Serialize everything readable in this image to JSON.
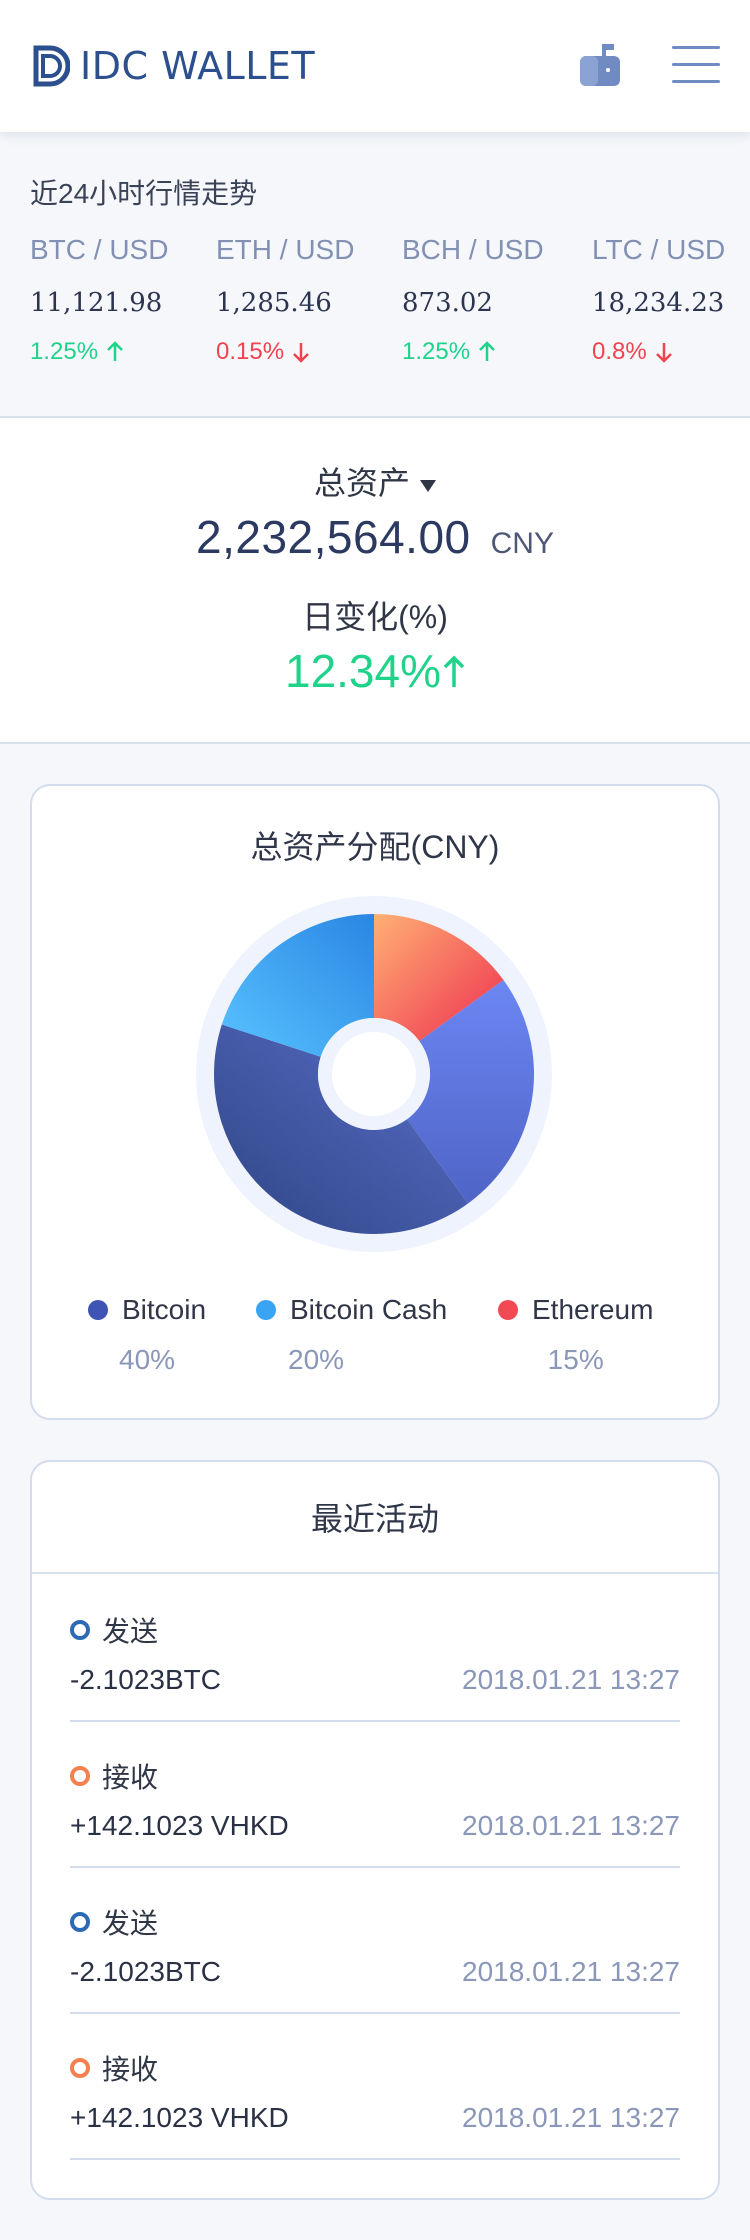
{
  "header": {
    "brand": "IDC WALLET"
  },
  "market": {
    "title": "近24小时行情走势",
    "tickers": [
      {
        "pair": "BTC / USD",
        "price": "11,121.98",
        "change": "1.25%",
        "direction": "up"
      },
      {
        "pair": "ETH / USD",
        "price": "1,285.46",
        "change": "0.15%",
        "direction": "down"
      },
      {
        "pair": "BCH / USD",
        "price": "873.02",
        "change": "1.25%",
        "direction": "up"
      },
      {
        "pair": "LTC / USD",
        "price": "18,234.23",
        "change": "0.8%",
        "direction": "down"
      }
    ]
  },
  "summary": {
    "total_label": "总资产",
    "total_value": "2,232,564.00",
    "currency": "CNY",
    "daily_label": "日变化(%)",
    "daily_value": "12.34%",
    "daily_direction": "up"
  },
  "allocation": {
    "title": "总资产分配(CNY)",
    "legend": [
      {
        "name": "Bitcoin",
        "percent": "40%"
      },
      {
        "name": "Bitcoin Cash",
        "percent": "20%"
      },
      {
        "name": "Ethereum",
        "percent": "15%"
      }
    ]
  },
  "chart_data": {
    "type": "pie",
    "title": "总资产分配(CNY)",
    "categories": [
      "Ethereum",
      "Unlabeled",
      "Bitcoin",
      "Bitcoin Cash"
    ],
    "values": [
      15,
      25,
      40,
      20
    ],
    "colors": [
      "#f24a55",
      "#5f7eea",
      "#31498f",
      "#3aa4f4"
    ]
  },
  "activity": {
    "title": "最近活动",
    "items": [
      {
        "type": "发送",
        "kind": "send",
        "amount": "-2.1023BTC",
        "time": "2018.01.21 13:27"
      },
      {
        "type": "接收",
        "kind": "receive",
        "amount": "+142.1023 VHKD",
        "time": "2018.01.21 13:27"
      },
      {
        "type": "发送",
        "kind": "send",
        "amount": "-2.1023BTC",
        "time": "2018.01.21 13:27"
      },
      {
        "type": "接收",
        "kind": "receive",
        "amount": "+142.1023 VHKD",
        "time": "2018.01.21 13:27"
      }
    ]
  },
  "colors": {
    "brand": "#2c4f8e",
    "up": "#1fd38a",
    "down": "#f0424f",
    "send": "#2d6ab6",
    "receive": "#f4814d"
  }
}
